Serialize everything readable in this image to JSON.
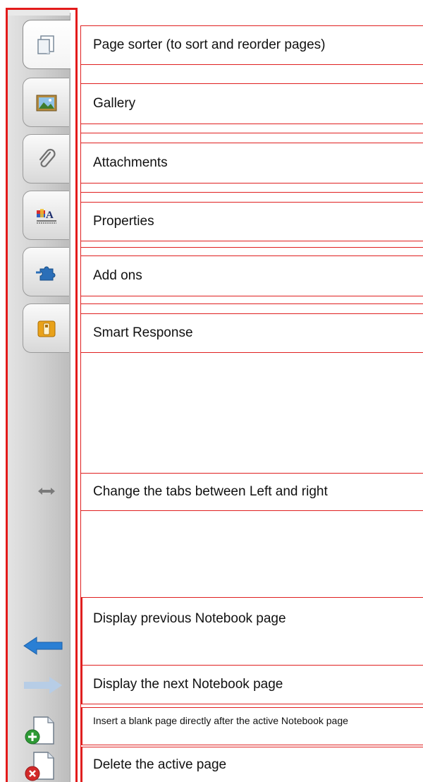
{
  "sidebar": {
    "tabs": [
      {
        "id": "page-sorter",
        "icon": "page-sorter-icon"
      },
      {
        "id": "gallery",
        "icon": "gallery-icon"
      },
      {
        "id": "attachments",
        "icon": "paperclip-icon"
      },
      {
        "id": "properties",
        "icon": "properties-icon"
      },
      {
        "id": "add-ons",
        "icon": "puzzle-icon"
      },
      {
        "id": "smart-response",
        "icon": "smart-response-icon"
      }
    ],
    "controls": [
      {
        "id": "move-sidebar",
        "icon": "left-right-arrow-icon"
      },
      {
        "id": "previous-page",
        "icon": "back-arrow-icon"
      },
      {
        "id": "next-page",
        "icon": "forward-arrow-icon"
      },
      {
        "id": "insert-page",
        "icon": "add-page-icon"
      },
      {
        "id": "delete-page",
        "icon": "delete-page-icon"
      }
    ]
  },
  "labels": {
    "page_sorter": "Page sorter (to sort and reorder pages)",
    "gallery": "Gallery",
    "attachments": "Attachments",
    "properties": "Properties",
    "add_ons": "Add ons",
    "smart_response": "Smart Response",
    "move_tabs": "Change the tabs between Left and right",
    "previous_page": "Display previous Notebook page",
    "next_page": "Display the next Notebook page",
    "insert_page": "Insert a blank page directly after the active Notebook page",
    "delete_page": "Delete the active page"
  },
  "colors": {
    "callout_border": "#e02020",
    "sidebar_bg": "#d0d0d0",
    "arrow_blue": "#2a7fd4",
    "arrow_disabled": "#b7cde6"
  }
}
